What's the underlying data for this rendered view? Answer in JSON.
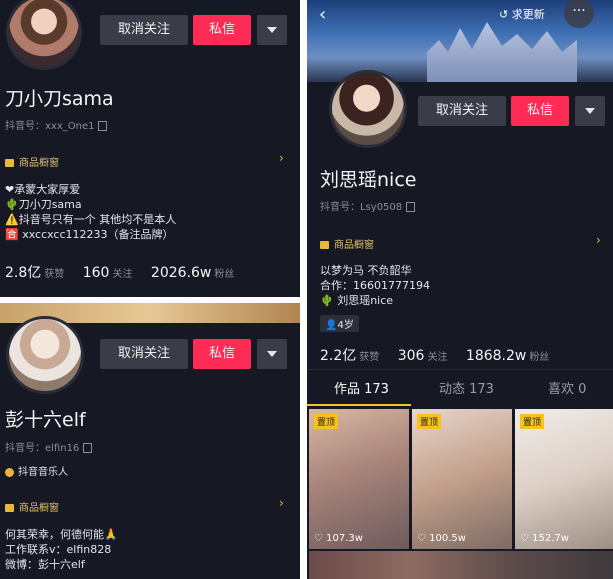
{
  "profile1": {
    "unfollow_label": "取消关注",
    "message_label": "私信",
    "name": "刀小刀sama",
    "douyin_id": "抖音号：xxx_One1",
    "shop_label": "商品橱窗",
    "bio_lines": [
      "❤承蒙大家厚爱",
      "🌵刀小刀sama",
      "⚠️抖音号只有一个 其他均不是本人",
      "🈴 xxccxcc112233（备注品牌）"
    ],
    "likes": "2.8亿",
    "likes_label": "获赞",
    "following": "160",
    "following_label": "关注",
    "fans": "2026.6w",
    "fans_label": "粉丝"
  },
  "profile2": {
    "unfollow_label": "取消关注",
    "message_label": "私信",
    "name": "彭十六elf",
    "douyin_id": "抖音号：elfin16",
    "verified": "抖音音乐人",
    "shop_label": "商品橱窗",
    "bio_lines": [
      "何其荣幸，何德何能🙏",
      "工作联系v：elfin828",
      "微博：彭十六elf"
    ]
  },
  "profile3": {
    "unfollow_label": "取消关注",
    "message_label": "私信",
    "update_label": "求更新",
    "name": "刘思瑶nice",
    "douyin_id": "抖音号：Lsy0508",
    "shop_label": "商品橱窗",
    "bio_lines": [
      "以梦为马 不负韶华",
      "合作：16601777194",
      "🌵 刘思瑶nice"
    ],
    "age_tag": "4岁",
    "likes": "2.2亿",
    "likes_label": "获赞",
    "following": "306",
    "following_label": "关注",
    "fans": "1868.2w",
    "fans_label": "粉丝",
    "tabs": [
      "作品 173",
      "动态 173",
      "喜欢 0"
    ],
    "videos": [
      {
        "badge": "置顶",
        "likes": "107.3w"
      },
      {
        "badge": "置顶",
        "likes": "100.5w"
      },
      {
        "badge": "置顶",
        "likes": "152.7w"
      }
    ]
  }
}
